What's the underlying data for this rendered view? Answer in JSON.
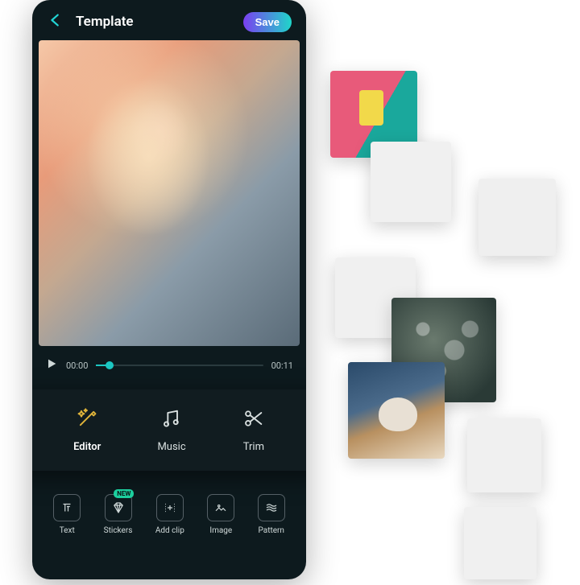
{
  "header": {
    "title": "Template",
    "save_label": "Save"
  },
  "timeline": {
    "current": "00:00",
    "total": "00:11"
  },
  "tabs": [
    {
      "label": "Editor",
      "icon": "wand-icon",
      "active": true
    },
    {
      "label": "Music",
      "icon": "music-icon",
      "active": false
    },
    {
      "label": "Trim",
      "icon": "scissors-icon",
      "active": false
    }
  ],
  "tools": [
    {
      "label": "Text",
      "icon": "text-icon"
    },
    {
      "label": "Stickers",
      "icon": "diamond-icon",
      "badge": "NEW"
    },
    {
      "label": "Add clip",
      "icon": "addclip-icon"
    },
    {
      "label": "Image",
      "icon": "image-icon"
    },
    {
      "label": "Pattern",
      "icon": "pattern-icon"
    }
  ]
}
